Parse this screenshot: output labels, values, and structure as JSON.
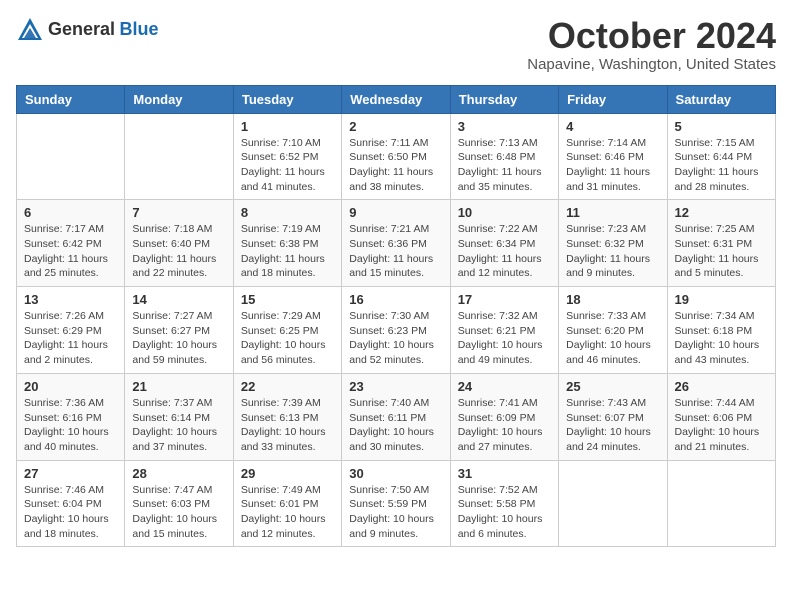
{
  "logo": {
    "general": "General",
    "blue": "Blue"
  },
  "header": {
    "month": "October 2024",
    "location": "Napavine, Washington, United States"
  },
  "weekdays": [
    "Sunday",
    "Monday",
    "Tuesday",
    "Wednesday",
    "Thursday",
    "Friday",
    "Saturday"
  ],
  "weeks": [
    [
      {
        "day": "",
        "info": ""
      },
      {
        "day": "",
        "info": ""
      },
      {
        "day": "1",
        "info": "Sunrise: 7:10 AM\nSunset: 6:52 PM\nDaylight: 11 hours and 41 minutes."
      },
      {
        "day": "2",
        "info": "Sunrise: 7:11 AM\nSunset: 6:50 PM\nDaylight: 11 hours and 38 minutes."
      },
      {
        "day": "3",
        "info": "Sunrise: 7:13 AM\nSunset: 6:48 PM\nDaylight: 11 hours and 35 minutes."
      },
      {
        "day": "4",
        "info": "Sunrise: 7:14 AM\nSunset: 6:46 PM\nDaylight: 11 hours and 31 minutes."
      },
      {
        "day": "5",
        "info": "Sunrise: 7:15 AM\nSunset: 6:44 PM\nDaylight: 11 hours and 28 minutes."
      }
    ],
    [
      {
        "day": "6",
        "info": "Sunrise: 7:17 AM\nSunset: 6:42 PM\nDaylight: 11 hours and 25 minutes."
      },
      {
        "day": "7",
        "info": "Sunrise: 7:18 AM\nSunset: 6:40 PM\nDaylight: 11 hours and 22 minutes."
      },
      {
        "day": "8",
        "info": "Sunrise: 7:19 AM\nSunset: 6:38 PM\nDaylight: 11 hours and 18 minutes."
      },
      {
        "day": "9",
        "info": "Sunrise: 7:21 AM\nSunset: 6:36 PM\nDaylight: 11 hours and 15 minutes."
      },
      {
        "day": "10",
        "info": "Sunrise: 7:22 AM\nSunset: 6:34 PM\nDaylight: 11 hours and 12 minutes."
      },
      {
        "day": "11",
        "info": "Sunrise: 7:23 AM\nSunset: 6:32 PM\nDaylight: 11 hours and 9 minutes."
      },
      {
        "day": "12",
        "info": "Sunrise: 7:25 AM\nSunset: 6:31 PM\nDaylight: 11 hours and 5 minutes."
      }
    ],
    [
      {
        "day": "13",
        "info": "Sunrise: 7:26 AM\nSunset: 6:29 PM\nDaylight: 11 hours and 2 minutes."
      },
      {
        "day": "14",
        "info": "Sunrise: 7:27 AM\nSunset: 6:27 PM\nDaylight: 10 hours and 59 minutes."
      },
      {
        "day": "15",
        "info": "Sunrise: 7:29 AM\nSunset: 6:25 PM\nDaylight: 10 hours and 56 minutes."
      },
      {
        "day": "16",
        "info": "Sunrise: 7:30 AM\nSunset: 6:23 PM\nDaylight: 10 hours and 52 minutes."
      },
      {
        "day": "17",
        "info": "Sunrise: 7:32 AM\nSunset: 6:21 PM\nDaylight: 10 hours and 49 minutes."
      },
      {
        "day": "18",
        "info": "Sunrise: 7:33 AM\nSunset: 6:20 PM\nDaylight: 10 hours and 46 minutes."
      },
      {
        "day": "19",
        "info": "Sunrise: 7:34 AM\nSunset: 6:18 PM\nDaylight: 10 hours and 43 minutes."
      }
    ],
    [
      {
        "day": "20",
        "info": "Sunrise: 7:36 AM\nSunset: 6:16 PM\nDaylight: 10 hours and 40 minutes."
      },
      {
        "day": "21",
        "info": "Sunrise: 7:37 AM\nSunset: 6:14 PM\nDaylight: 10 hours and 37 minutes."
      },
      {
        "day": "22",
        "info": "Sunrise: 7:39 AM\nSunset: 6:13 PM\nDaylight: 10 hours and 33 minutes."
      },
      {
        "day": "23",
        "info": "Sunrise: 7:40 AM\nSunset: 6:11 PM\nDaylight: 10 hours and 30 minutes."
      },
      {
        "day": "24",
        "info": "Sunrise: 7:41 AM\nSunset: 6:09 PM\nDaylight: 10 hours and 27 minutes."
      },
      {
        "day": "25",
        "info": "Sunrise: 7:43 AM\nSunset: 6:07 PM\nDaylight: 10 hours and 24 minutes."
      },
      {
        "day": "26",
        "info": "Sunrise: 7:44 AM\nSunset: 6:06 PM\nDaylight: 10 hours and 21 minutes."
      }
    ],
    [
      {
        "day": "27",
        "info": "Sunrise: 7:46 AM\nSunset: 6:04 PM\nDaylight: 10 hours and 18 minutes."
      },
      {
        "day": "28",
        "info": "Sunrise: 7:47 AM\nSunset: 6:03 PM\nDaylight: 10 hours and 15 minutes."
      },
      {
        "day": "29",
        "info": "Sunrise: 7:49 AM\nSunset: 6:01 PM\nDaylight: 10 hours and 12 minutes."
      },
      {
        "day": "30",
        "info": "Sunrise: 7:50 AM\nSunset: 5:59 PM\nDaylight: 10 hours and 9 minutes."
      },
      {
        "day": "31",
        "info": "Sunrise: 7:52 AM\nSunset: 5:58 PM\nDaylight: 10 hours and 6 minutes."
      },
      {
        "day": "",
        "info": ""
      },
      {
        "day": "",
        "info": ""
      }
    ]
  ]
}
